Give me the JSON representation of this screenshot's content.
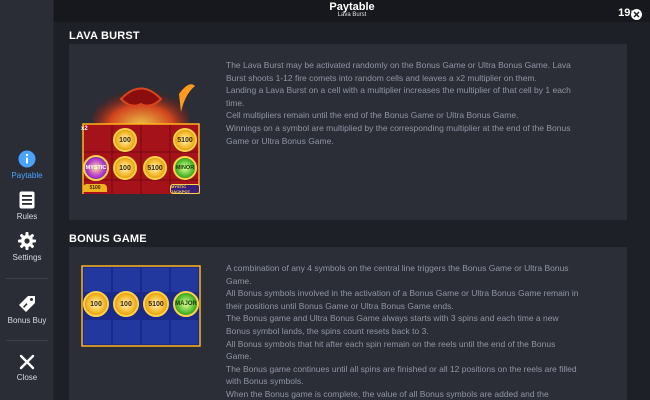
{
  "header": {
    "title": "Paytable",
    "subtitle": "Lava Burst",
    "clock": "19:"
  },
  "sidebar": {
    "items": [
      {
        "label": "Paytable",
        "icon": "info-icon",
        "active": true
      },
      {
        "label": "Rules",
        "icon": "rules-list-icon",
        "active": false
      },
      {
        "label": "Settings",
        "icon": "gear-icon",
        "active": false
      },
      {
        "label": "Bonus Buy",
        "icon": "price-tag-icon",
        "active": false
      },
      {
        "label": "Close",
        "icon": "close-icon",
        "active": false
      }
    ]
  },
  "sections": [
    {
      "title": "LAVA BURST",
      "paragraphs": [
        "The Lava Burst may be activated randomly on the Bonus Game or Ultra Bonus Game. Lava Burst shoots 1-12 fire comets into random cells and leaves a x2 multiplier on them.",
        "Landing a Lava Burst on a cell with a multiplier increases the multiplier of that cell by 1 each time.",
        "Cell multipliers remain until the end of the Bonus Game or Ultra Bonus Game.",
        "Winnings on a symbol are multiplied by the corresponding multiplier at the end of the Bonus Game or Ultra Bonus Game."
      ],
      "art": {
        "multiplier_tag": "x2",
        "coins": [
          "100",
          "5100",
          "MYSTIC",
          "100",
          "5100",
          "MINOR",
          "5100",
          "MYSTIC JACKPOT"
        ]
      }
    },
    {
      "title": "BONUS GAME",
      "paragraphs": [
        "A combination of any 4 symbols on the central line triggers the Bonus Game or Ultra Bonus Game.",
        "All Bonus symbols involved in the activation of a Bonus Game or Ultra Bonus Game remain in their positions until Bonus Game or Ultra Bonus Game ends.",
        "The Bonus game and Ultra Bonus Game always starts with 3 spins and each time a new Bonus symbol lands, the spins count resets back to 3.",
        "All Bonus symbols that hit after each spin remain on the reels until the end of the Bonus Game.",
        "The Bonus game continues until all spins are finished or all 12 positions on the reels are filled with Bonus symbols.",
        "When the Bonus game is complete, the value of all Bonus symbols are added and the"
      ],
      "art": {
        "coins": [
          "100",
          "100",
          "5100",
          "MAJOR"
        ]
      }
    }
  ],
  "colors": {
    "accent": "#4aa3ff",
    "background": "#1e2027",
    "panel": "#2b2e37",
    "sidebar": "#2a2d36",
    "gold": "#f2b21c",
    "red": "#b3141a"
  }
}
